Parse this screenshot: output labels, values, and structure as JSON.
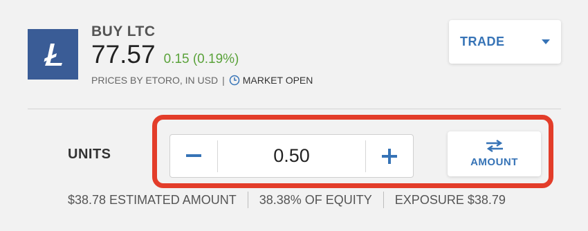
{
  "instrument": {
    "title": "BUY LTC",
    "price": "77.57",
    "change": "0.15 (0.19%)",
    "prices_by": "PRICES BY ETORO, IN USD",
    "separator": "|",
    "market_status": "MARKET OPEN",
    "logo_icon": "litecoin-logo",
    "logo_color": "#3a5c96",
    "change_color": "#5aa23a"
  },
  "trade_button": {
    "label": "TRADE",
    "icon": "caret-down-icon"
  },
  "order": {
    "units_label": "UNITS",
    "units_value": "0.50",
    "minus_icon": "minus-icon",
    "plus_icon": "plus-icon",
    "toggle_label": "AMOUNT",
    "toggle_icon": "swap-arrows-icon",
    "highlight_color": "#e33d2a",
    "accent_color": "#3673b6"
  },
  "summary": {
    "estimated_amount": "$38.78 ESTIMATED AMOUNT",
    "equity": "38.38% OF EQUITY",
    "exposure": "EXPOSURE $38.79"
  }
}
